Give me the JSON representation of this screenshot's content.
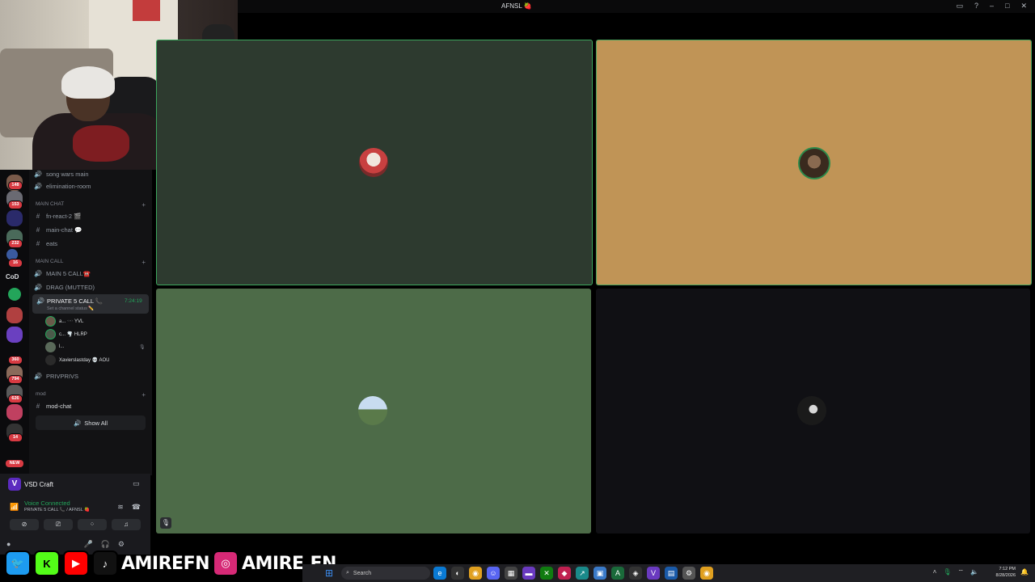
{
  "window": {
    "title": "AFNSL 🍓",
    "buttons": [
      "▭",
      "?",
      "–",
      "□",
      "✕"
    ]
  },
  "rail": {
    "servers": [
      {
        "badge": "148",
        "color": "#7a5a4a"
      },
      {
        "badge": "153",
        "color": "#6a6a72"
      },
      {
        "badge": "",
        "color": "#2a2a6a"
      },
      {
        "badge": "232",
        "color": "#4a6a5a"
      },
      {
        "badge": "16",
        "color": "#3a5aa0"
      },
      {
        "badge": "",
        "color": "#23a55a"
      },
      {
        "badge": "",
        "color": "#b04040"
      },
      {
        "badge": "",
        "color": "#6a40c0"
      },
      {
        "badge": "360",
        "color": "#444"
      },
      {
        "badge": "794",
        "color": "#8a6a5a"
      },
      {
        "badge": "626",
        "color": "#5a5a5a"
      },
      {
        "badge": "",
        "color": "#c04060"
      },
      {
        "badge": "14",
        "color": "#333"
      }
    ],
    "cod_label": "CoD",
    "new_badge": "NEW"
  },
  "channels": {
    "items": [
      {
        "icon": "🔊",
        "label": "song wars main"
      },
      {
        "icon": "🔊",
        "label": "elimination-room"
      }
    ],
    "cat_main_chat": "MAIN CHAT",
    "main_chat_items": [
      {
        "icon": "#",
        "label": "fn-react-2 🎬"
      },
      {
        "icon": "#",
        "label": "main-chat 💬"
      },
      {
        "icon": "#",
        "label": "eats"
      }
    ],
    "cat_main_call": "MAIN CALL",
    "main_call_items": [
      {
        "icon": "🔊",
        "label": "MAIN 5 CALL☎️"
      },
      {
        "icon": "🔊",
        "label": "DRAG (MUTTED)"
      }
    ],
    "active": {
      "label": "PRIVATE 5 CALL 📞",
      "timer": "7:24:19",
      "status": "Set a channel status ✏️"
    },
    "voice_users": [
      "a... 🕶️ YVL",
      "c... 🌪️ HLRP",
      "l...",
      "Xavierslastday 💀 AOU"
    ],
    "privprivs": "PRIVPRIVS",
    "cat_mod": "mod",
    "mod_chat": "mod-chat",
    "show_all": "Show All"
  },
  "userpanel": {
    "server_name": "VSD Craft",
    "server_icon": "V",
    "voice_status": "Voice Connected",
    "voice_channel": "PRIVATE 5 CALL 📞 / AFNSL 🍓"
  },
  "tiles": [
    {
      "color": "#2d3a2f",
      "border": "#3ba55c",
      "avatar": "#c84040"
    },
    {
      "color": "#c09456",
      "border": "#4aa35c",
      "avatar": "#3a2a1e"
    },
    {
      "color": "#4d6b48",
      "border": "#4d6b48",
      "avatar": "#9ab8d8"
    },
    {
      "color": "#101014",
      "border": "#101014",
      "avatar": "#2a2a2a"
    }
  ],
  "social": {
    "handle1": "AMIREFN",
    "handle2": "AMIRE.FN"
  },
  "taskbar": {
    "search_placeholder": "Search",
    "time": "7:12 PM",
    "date": "8/28/2026"
  }
}
